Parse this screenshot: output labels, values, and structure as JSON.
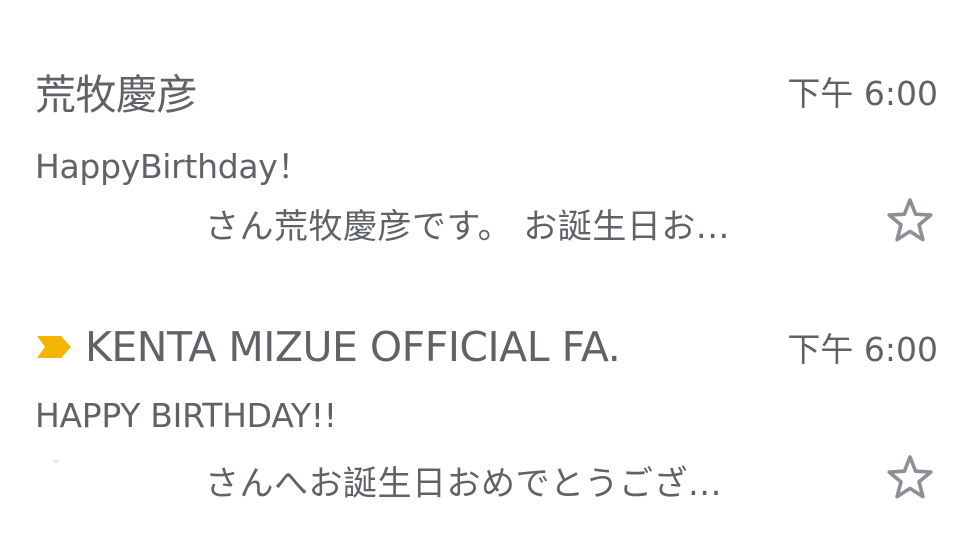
{
  "emails": [
    {
      "sender": "荒牧慶彦",
      "time": "下午 6:00",
      "subject": "HappyBirthday！",
      "snippet": "さん荒牧慶彦です。  お誕生日お...",
      "starred": false,
      "important": false
    },
    {
      "sender": "KENTA MIZUE OFFICIAL FA.",
      "time": "下午 6:00",
      "subject": "HAPPY BIRTHDAY!!",
      "snippet": "さんへお誕生日おめでとうござ...",
      "starred": false,
      "important": true
    }
  ],
  "icons": {
    "star": "star-outline-icon",
    "importance": "importance-marker-icon"
  },
  "colors": {
    "text": "#5f6368",
    "star_outline": "#8b8f96",
    "importance": "#f4b400",
    "background": "#ffffff"
  }
}
